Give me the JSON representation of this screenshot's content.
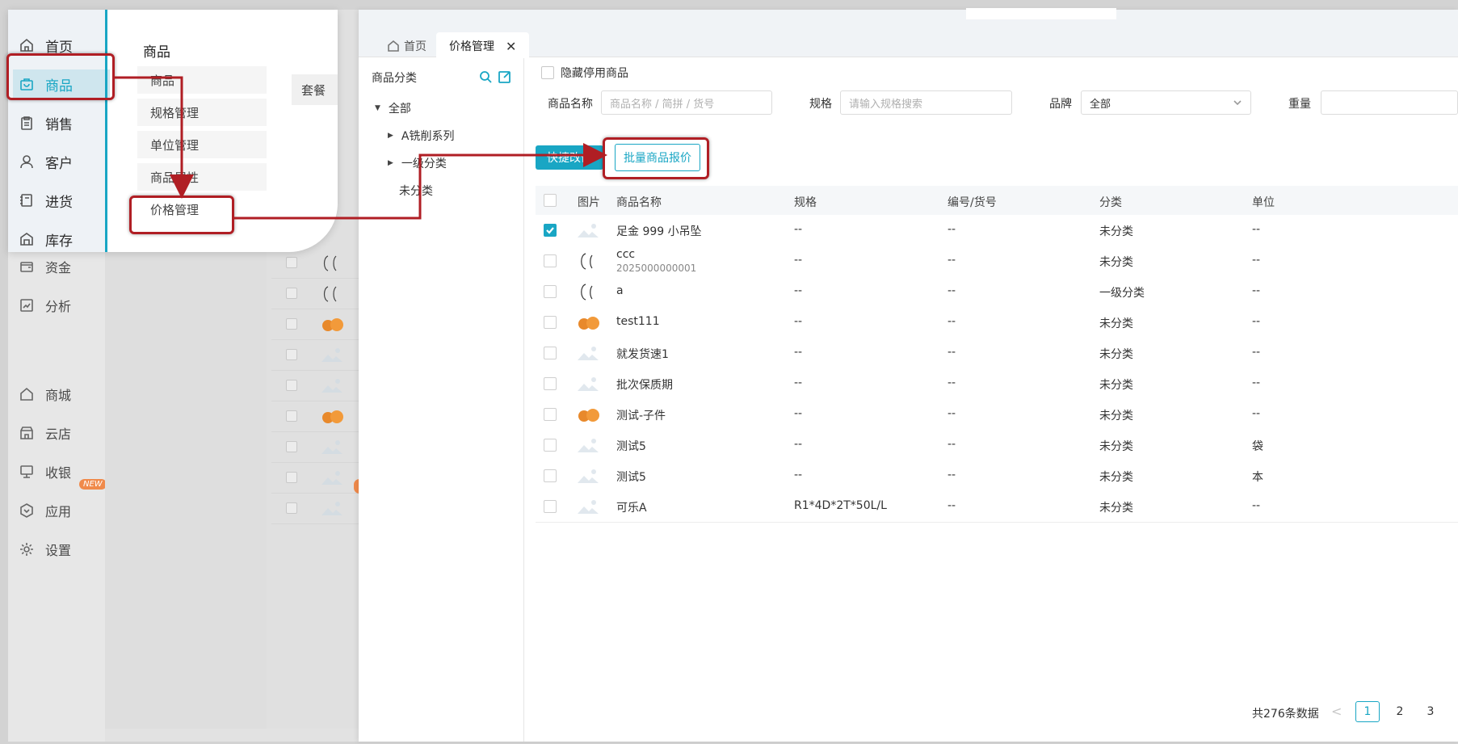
{
  "bg_sidebar": {
    "items": [
      {
        "label": "资金",
        "icon": "wallet-icon"
      },
      {
        "label": "分析",
        "icon": "chart-icon"
      },
      {
        "label": "商城",
        "icon": "home-icon"
      },
      {
        "label": "云店",
        "icon": "store-icon"
      },
      {
        "label": "收银",
        "icon": "monitor-icon"
      },
      {
        "label": "应用",
        "icon": "hexagon-icon"
      },
      {
        "label": "设置",
        "icon": "gear-icon"
      }
    ],
    "new_badge": "NEW"
  },
  "popup": {
    "nav": [
      {
        "label": "首页",
        "icon": "home-icon"
      },
      {
        "label": "商品",
        "icon": "bag-icon"
      },
      {
        "label": "销售",
        "icon": "clipboard-icon"
      },
      {
        "label": "客户",
        "icon": "user-icon"
      },
      {
        "label": "进货",
        "icon": "book-icon"
      },
      {
        "label": "库存",
        "icon": "warehouse-icon"
      }
    ],
    "title": "商品",
    "sub_items": [
      "商品",
      "规格管理",
      "单位管理",
      "商品属性",
      "价格管理"
    ],
    "extra_item": "套餐"
  },
  "tabs": {
    "home": "首页",
    "price": "价格管理",
    "close": "✕"
  },
  "category": {
    "title": "商品分类",
    "tree": [
      {
        "label": "全部",
        "caret": "▼"
      },
      {
        "label": "A铣削系列",
        "caret": "▶"
      },
      {
        "label": "一级分类",
        "caret": "▶"
      },
      {
        "label": "未分类",
        "caret": ""
      }
    ]
  },
  "filters": {
    "hide_disabled": "隐藏停用商品",
    "name_label": "商品名称",
    "name_placeholder": "商品名称 / 简拼 / 货号",
    "spec_label": "规格",
    "spec_placeholder": "请输入规格搜索",
    "brand_label": "品牌",
    "brand_value": "全部",
    "weight_label": "重量"
  },
  "buttons": {
    "quick": "快捷改价",
    "batch": "批量商品报价"
  },
  "table": {
    "headers": [
      "图片",
      "商品名称",
      "规格",
      "编号/货号",
      "分类",
      "单位"
    ],
    "rows": [
      {
        "checked": true,
        "thumb": "placeholder",
        "name": "足金 999 小吊坠",
        "code_sub": "",
        "spec": "--",
        "code": "--",
        "category": "未分类",
        "unit": "--"
      },
      {
        "checked": false,
        "thumb": "sketch",
        "name": "ccc",
        "code_sub": "2025000000001",
        "spec": "--",
        "code": "--",
        "category": "未分类",
        "unit": "--"
      },
      {
        "checked": false,
        "thumb": "sketch",
        "name": "a",
        "code_sub": "",
        "spec": "--",
        "code": "--",
        "category": "一级分类",
        "unit": "--"
      },
      {
        "checked": false,
        "thumb": "orange",
        "name": "test111",
        "code_sub": "",
        "spec": "--",
        "code": "--",
        "category": "未分类",
        "unit": "--"
      },
      {
        "checked": false,
        "thumb": "placeholder",
        "name": "就发货速1",
        "code_sub": "",
        "spec": "--",
        "code": "--",
        "category": "未分类",
        "unit": "--"
      },
      {
        "checked": false,
        "thumb": "placeholder",
        "name": "批次保质期",
        "code_sub": "",
        "spec": "--",
        "code": "--",
        "category": "未分类",
        "unit": "--"
      },
      {
        "checked": false,
        "thumb": "orange",
        "name": "测试-子件",
        "code_sub": "",
        "spec": "--",
        "code": "--",
        "category": "未分类",
        "unit": "--"
      },
      {
        "checked": false,
        "thumb": "placeholder",
        "name": "测试5",
        "code_sub": "",
        "spec": "--",
        "code": "--",
        "category": "未分类",
        "unit": "袋"
      },
      {
        "checked": false,
        "thumb": "placeholder",
        "name": "测试5",
        "code_sub": "",
        "spec": "--",
        "code": "--",
        "category": "未分类",
        "unit": "本"
      },
      {
        "checked": false,
        "thumb": "placeholder",
        "name": "可乐A",
        "code_sub": "",
        "spec": "R1*4D*2T*50L/L",
        "code": "--",
        "category": "未分类",
        "unit": "--"
      }
    ]
  },
  "pagination": {
    "total": "共276条数据",
    "prev": "<",
    "pages": [
      "1",
      "2",
      "3"
    ]
  },
  "colors": {
    "accent": "#19a6c4",
    "highlight": "#b01e24",
    "orange": "#f08a4b"
  }
}
